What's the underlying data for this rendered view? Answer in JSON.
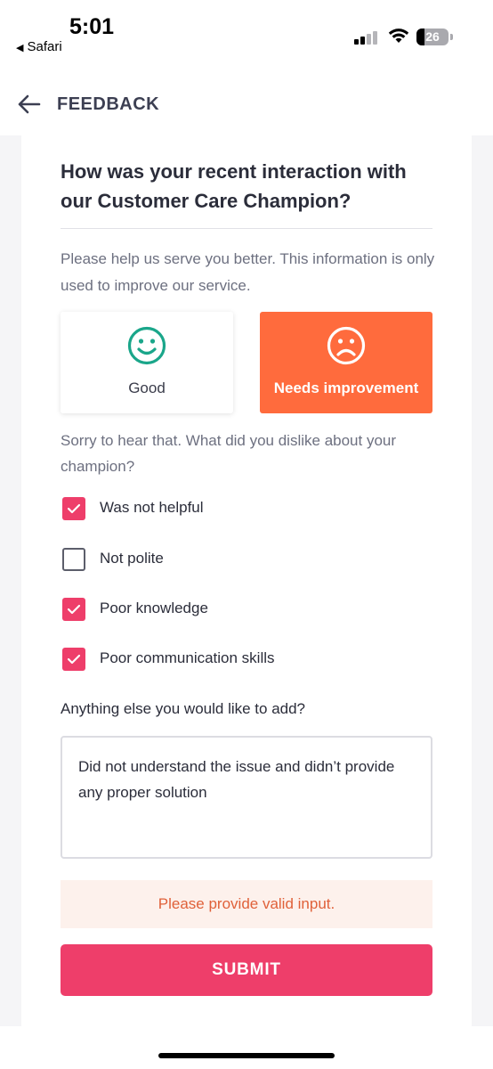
{
  "status_bar": {
    "time": "5:01",
    "back_app": "Safari",
    "back_app_glyph": "◀",
    "battery": "26"
  },
  "header": {
    "title": "FEEDBACK",
    "back_icon": "arrow-left-icon"
  },
  "form": {
    "question": "How was your recent interaction with our Customer Care Champion?",
    "subtext": "Please help us serve you better. This information is only used to improve our service.",
    "options": [
      {
        "label": "Good",
        "icon": "smile-face-icon",
        "selected": false,
        "color": "#1aa68a"
      },
      {
        "label": "Needs improvement",
        "icon": "sad-face-icon",
        "selected": true,
        "color": "#ff6b3d"
      }
    ],
    "dislike_prompt": "Sorry to hear that. What did you dislike about your champion?",
    "dislike_reasons": [
      {
        "label": "Was not helpful",
        "checked": true
      },
      {
        "label": "Not polite",
        "checked": false
      },
      {
        "label": "Poor knowledge",
        "checked": true
      },
      {
        "label": "Poor communication skills",
        "checked": true
      }
    ],
    "additional_prompt": "Anything else you would like to add?",
    "additional_text": "Did not understand the issue and didn’t provide any proper solution",
    "error_message": "Please provide valid input.",
    "submit_label": "SUBMIT"
  },
  "colors": {
    "accent": "#ee3e6a",
    "selected_option": "#ff6b3d",
    "error_text": "#e0613a",
    "error_bg": "#fdf1ec"
  }
}
